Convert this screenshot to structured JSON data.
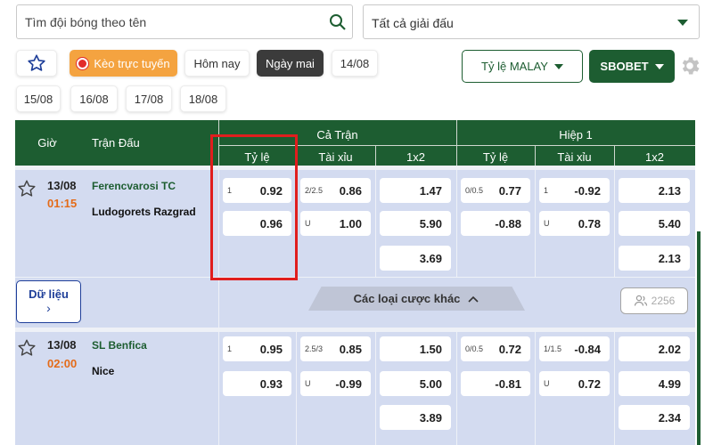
{
  "search": {
    "placeholder": "Tìm đội bóng theo tên"
  },
  "league_select": {
    "value": "Tất cả giải đấu"
  },
  "chips": {
    "live": "Kèo trực tuyến",
    "today": "Hôm nay",
    "tomorrow": "Ngày mai",
    "d1": "14/08",
    "d2": "15/08",
    "d3": "16/08",
    "d4": "17/08",
    "d5": "18/08"
  },
  "odds_type": "Tỷ lệ MALAY",
  "bookmaker": "SBOBET",
  "header": {
    "time": "Giờ",
    "match": "Trận Đấu",
    "full": "Cả Trận",
    "half": "Hiệp 1",
    "handicap": "Tỷ lệ",
    "ou": "Tài xỉu",
    "x12": "1x2",
    "handicap_h": "Tỷ lệ",
    "ou_h": "Tài xỉu",
    "x12_h": "1x2"
  },
  "matches": [
    {
      "date": "13/08",
      "time": "01:15",
      "home": "Ferencvarosi TC",
      "away": "Ludogorets Razgrad",
      "full": {
        "hdp_line": "1",
        "hdp_home": "0.92",
        "hdp_away": "0.96",
        "ou_line": "2/2.5",
        "ou_over": "0.86",
        "ou_under_label": "U",
        "ou_under": "1.00",
        "x1": "1.47",
        "xx": "5.90",
        "x2": "3.69"
      },
      "half": {
        "hdp_line": "0/0.5",
        "hdp_home": "0.77",
        "hdp_away": "-0.88",
        "ou_line": "1",
        "ou_over": "-0.92",
        "ou_under_label": "U",
        "ou_under": "0.78",
        "x1": "2.13",
        "xx": "5.40",
        "x2": "2.13"
      }
    },
    {
      "date": "13/08",
      "time": "02:00",
      "home": "SL Benfica",
      "away": "Nice",
      "full": {
        "hdp_line": "1",
        "hdp_home": "0.95",
        "hdp_away": "0.93",
        "ou_line": "2.5/3",
        "ou_over": "0.85",
        "ou_under_label": "U",
        "ou_under": "-0.99",
        "x1": "1.50",
        "xx": "5.00",
        "x2": "3.89"
      },
      "half": {
        "hdp_line": "0/0.5",
        "hdp_home": "0.72",
        "hdp_away": "-0.81",
        "ou_line": "1/1.5",
        "ou_over": "-0.84",
        "ou_under_label": "U",
        "ou_under": "0.72",
        "x1": "2.02",
        "xx": "4.99",
        "x2": "2.34"
      }
    }
  ],
  "data_button": {
    "label": "Dữ liệu",
    "chevron": "›"
  },
  "more_bets": "Các loại cược khác",
  "watch_count": "2256",
  "colors": {
    "brand_green": "#1d5d31",
    "live_orange": "#f4a340",
    "time_orange": "#e46b18",
    "highlight_red": "#e01e1e",
    "table_bg": "#d3dbf0"
  }
}
